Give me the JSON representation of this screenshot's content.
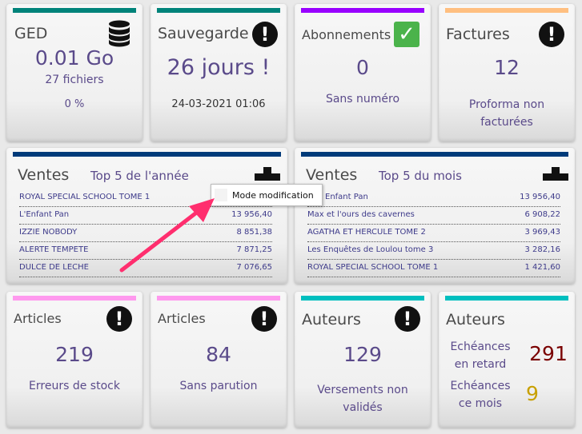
{
  "colors": {
    "text_purple": "#5a4a8a",
    "ged_bar": "#00837a",
    "sauvegarde_bar": "#00837a",
    "abonnements_bar": "#9900ff",
    "factures_bar": "#ffbf80",
    "ventes_bar": "#003b7a",
    "articles_bar": "#ff99ee",
    "auteurs_bar": "#00bfbf",
    "late_red": "#7a0000",
    "month_gold": "#c8a000"
  },
  "ged": {
    "title": "GED",
    "size": "0.01 Go",
    "files": "27 fichiers",
    "percent": "0 %",
    "icon": "database-icon"
  },
  "sauvegarde": {
    "title": "Sauvegarde",
    "days": "26 jours !",
    "date": "24-03-2021 01:06",
    "icon": "warning-icon"
  },
  "abonnements": {
    "title": "Abonnements",
    "count": "0",
    "label": "Sans numéro",
    "icon": "check-icon"
  },
  "factures": {
    "title": "Factures",
    "count": "12",
    "label_line1": "Proforma non",
    "label_line2": "facturées",
    "icon": "warning-icon"
  },
  "ventes_annee": {
    "title": "Ventes",
    "subtitle": "Top 5 de l'année",
    "icon": "stamp-icon",
    "rows": [
      {
        "name": "ROYAL SPECIAL SCHOOL TOME 1",
        "value": ""
      },
      {
        "name": "L'Enfant Pan",
        "value": "13 956,40"
      },
      {
        "name": "IZZIE NOBODY",
        "value": "8 851,38"
      },
      {
        "name": "ALERTE TEMPETE",
        "value": "7 871,25"
      },
      {
        "name": "DULCE DE LECHE",
        "value": "7 076,65"
      }
    ]
  },
  "ventes_mois": {
    "title": "Ventes",
    "subtitle": "Top 5 du mois",
    "icon": "stamp-icon",
    "rows": [
      {
        "name": "Enfant Pan",
        "value": "13 956,40"
      },
      {
        "name": "Max et l'ours des cavernes",
        "value": "6 908,22"
      },
      {
        "name": "AGATHA ET HERCULE TOME 2",
        "value": "3 969,43"
      },
      {
        "name": "Les Enquêtes de Loulou tome 3",
        "value": "3 282,16"
      },
      {
        "name": "ROYAL SPECIAL SCHOOL TOME 1",
        "value": "1 421,60"
      }
    ]
  },
  "tooltip": {
    "label": "Mode modification"
  },
  "articles_stock": {
    "title": "Articles",
    "count": "219",
    "label": "Erreurs de stock",
    "icon": "warning-icon"
  },
  "articles_parution": {
    "title": "Articles",
    "count": "84",
    "label": "Sans parution",
    "icon": "warning-icon"
  },
  "auteurs_versements": {
    "title": "Auteurs",
    "count": "129",
    "label_line1": "Versements non",
    "label_line2": "validés",
    "icon": "warning-icon"
  },
  "auteurs_echeances": {
    "title": "Auteurs",
    "late_line1": "Echéances",
    "late_line2": "en retard",
    "late_count": "291",
    "month_line1": "Echéances",
    "month_line2": "ce mois",
    "month_count": "9"
  }
}
